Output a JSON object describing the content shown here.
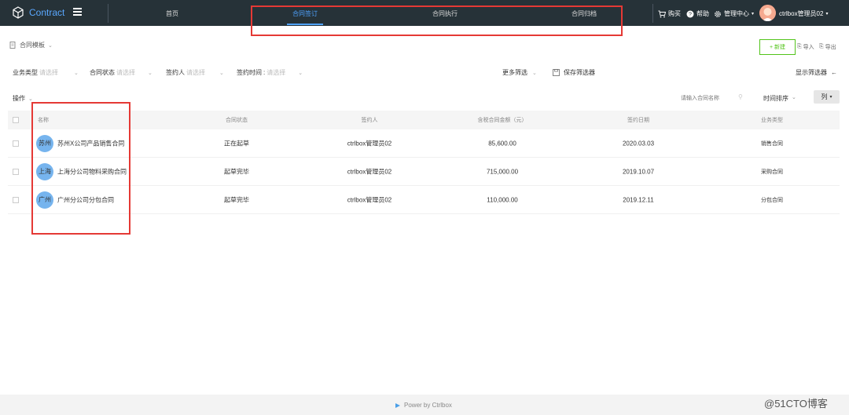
{
  "app": {
    "name": "Contract",
    "brand_color": "#5aa8ff",
    "topbar_color": "#263238"
  },
  "nav": {
    "tabs": [
      {
        "label": "首页"
      },
      {
        "label": "合同签订",
        "active": true
      },
      {
        "label": "合同执行"
      },
      {
        "label": "合同归档"
      }
    ]
  },
  "topbar_right": {
    "buy_label": "购买",
    "help_label": "帮助",
    "admin_label": "管理中心",
    "user_label": "ctrlbox管理员02"
  },
  "breadcrumb": {
    "label": "合同模板"
  },
  "toolbar": {
    "new_label": "新建",
    "import_label": "导入",
    "export_label": "导出"
  },
  "filters": [
    {
      "label": "业务类型",
      "placeholder": "请选择"
    },
    {
      "label": "合同状态",
      "placeholder": "请选择"
    },
    {
      "label": "签约人",
      "placeholder": "请选择"
    },
    {
      "label": "签约时间",
      "placeholder": "请选择"
    }
  ],
  "filter_actions": {
    "more_label": "更多筛选",
    "save_label": "保存筛选器",
    "show_label": "显示筛选器"
  },
  "table_toolbar": {
    "ops_label": "操作",
    "search_placeholder": "请输入合同名称",
    "sort_label": "时间排序",
    "columns_label": "列"
  },
  "table": {
    "headers": [
      "名称",
      "合同状态",
      "签约人",
      "含税合同金额（元）",
      "签约日期",
      "业务类型"
    ],
    "rows": [
      {
        "badge": "苏州",
        "name": "苏州X公司产品销售合同",
        "status": "正在起草",
        "signer": "ctrlbox管理员02",
        "amount": "85,600.00",
        "date": "2020.03.03",
        "type": "销售合同"
      },
      {
        "badge": "上海",
        "name": "上海分公司物料采购合同",
        "status": "起草完毕",
        "signer": "ctrlbox管理员02",
        "amount": "715,000.00",
        "date": "2019.10.07",
        "type": "采购合同"
      },
      {
        "badge": "广州",
        "name": "广州分公司分包合同",
        "status": "起草完毕",
        "signer": "ctrlbox管理员02",
        "amount": "110,000.00",
        "date": "2019.12.11",
        "type": "分包合同"
      }
    ]
  },
  "footer": {
    "powered": "Power by Ctrlbox"
  },
  "watermark": "@51CTO博客",
  "annotation_color": "#e53935"
}
